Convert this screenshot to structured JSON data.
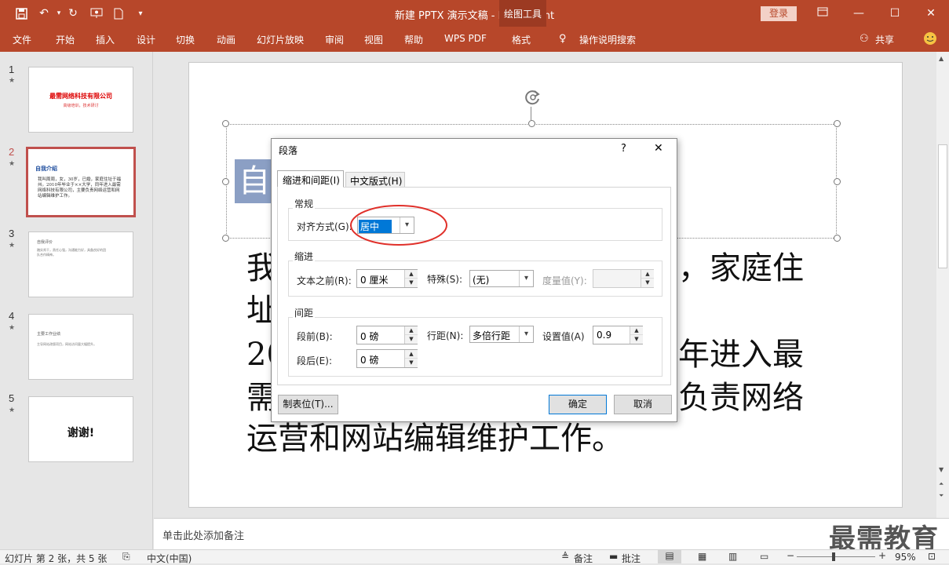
{
  "window": {
    "title": "新建 PPTX 演示文稿  -  PowerPoint",
    "tool_tab": "绘图工具",
    "login": "登录",
    "share": "共享"
  },
  "ribbon_tabs": [
    "文件",
    "开始",
    "插入",
    "设计",
    "切换",
    "动画",
    "幻灯片放映",
    "审阅",
    "视图",
    "帮助",
    "WPS PDF",
    "格式"
  ],
  "tell_me": "操作说明搜索",
  "slides": [
    {
      "num": "1",
      "title": "最需网络科技有限公司",
      "subtitle": "高级培训，技术研讨"
    },
    {
      "num": "2",
      "title": "自我介绍",
      "body": "我叫周周，女，30岁，已婚，家庭住址于福州。2010年毕业于××大学，同年进入最需网络科技有限公司，主要负责网络运营和网站编辑维护工作。"
    },
    {
      "num": "3",
      "title": "自我评价",
      "body": "踏实肯干，责任心强，沟通能力好，具备良好的团队合作精神。"
    },
    {
      "num": "4",
      "title": "主要工作业绩",
      "body": "主导网站改版项目，网站访问量大幅提升。"
    },
    {
      "num": "5",
      "title": "谢谢!"
    }
  ],
  "slide_text": {
    "line1": "我",
    "line1_right": "，家庭住",
    "line2": "址",
    "line3_left": "20",
    "line3_right": "年进入最",
    "line4_left": "需",
    "line4_right": "负责网络",
    "line5": "运营和网站编辑维护工作。",
    "title_char": "自"
  },
  "dialog": {
    "title": "段落",
    "help": "?",
    "close": "✕",
    "tabs": [
      "缩进和间距(I)",
      "中文版式(H)"
    ],
    "general": {
      "title": "常规",
      "align_label": "对齐方式(G):",
      "align_value": "居中"
    },
    "indent": {
      "title": "缩进",
      "before_label": "文本之前(R):",
      "before_value": "0 厘米",
      "special_label": "特殊(S):",
      "special_value": "(无)",
      "measure_label": "度量值(Y):",
      "measure_value": ""
    },
    "spacing": {
      "title": "间距",
      "before_label": "段前(B):",
      "before_value": "0 磅",
      "after_label": "段后(E):",
      "after_value": "0 磅",
      "line_label": "行距(N):",
      "line_value": "多倍行距",
      "set_label": "设置值(A)",
      "set_value": "0.9"
    },
    "tabs_button": "制表位(T)...",
    "ok": "确定",
    "cancel": "取消"
  },
  "notes_placeholder": "单击此处添加备注",
  "watermark": "最需教育",
  "status": {
    "slide_info": "幻灯片 第 2 张，共 5 张",
    "language": "中文(中国)",
    "notes": "备注",
    "comments": "批注",
    "zoom": "95%"
  },
  "colors": {
    "brand": "#b7472a",
    "highlight_circle": "#e0302a",
    "selection": "#0078d7"
  }
}
